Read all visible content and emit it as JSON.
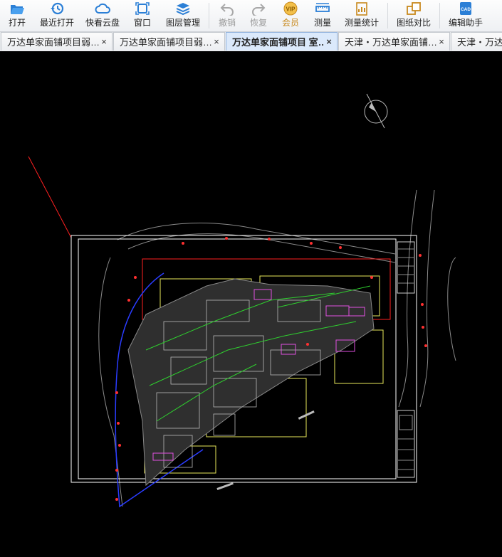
{
  "toolbar": {
    "open": {
      "label": "打开",
      "icon": "folder-open-icon"
    },
    "recent": {
      "label": "最近打开",
      "icon": "history-icon"
    },
    "cloud": {
      "label": "快看云盘",
      "icon": "cloud-icon"
    },
    "window": {
      "label": "窗口",
      "icon": "window-icon"
    },
    "layers": {
      "label": "图层管理",
      "icon": "layers-icon"
    },
    "undo": {
      "label": "撤销",
      "icon": "undo-icon"
    },
    "redo": {
      "label": "恢复",
      "icon": "redo-icon"
    },
    "vip": {
      "label": "会员",
      "icon": "vip-icon",
      "badge": "VIP"
    },
    "measure": {
      "label": "测量",
      "icon": "ruler-icon"
    },
    "measure_stats": {
      "label": "测量统计",
      "icon": "measure-stats-icon"
    },
    "compare": {
      "label": "图纸对比",
      "icon": "compare-icon"
    },
    "edit_helper": {
      "label": "编辑助手",
      "icon": "edit-helper-icon",
      "badge": "CAD"
    }
  },
  "tabs": [
    {
      "title": "万达单家面铺项目弱…",
      "close": "×"
    },
    {
      "title": "万达单家面铺项目弱…",
      "close": "×"
    },
    {
      "title": "万达单家面铺项目 室…",
      "close": "×",
      "active": true
    },
    {
      "title": "天津・万达单家面铺…",
      "close": "×"
    },
    {
      "title": "天津・万达…",
      "close": ""
    }
  ],
  "colors": {
    "canvas_bg": "#000000",
    "border_white": "#ffffff",
    "site_red": "#ff2020",
    "zone_yellow": "#e8e85a",
    "boundary_blue": "#2a3cff",
    "road_gray": "#9a9a9a",
    "building_magenta": "#e050e0",
    "pipe_green": "#2fd02f",
    "accent_blue": "#2b7fd6"
  }
}
